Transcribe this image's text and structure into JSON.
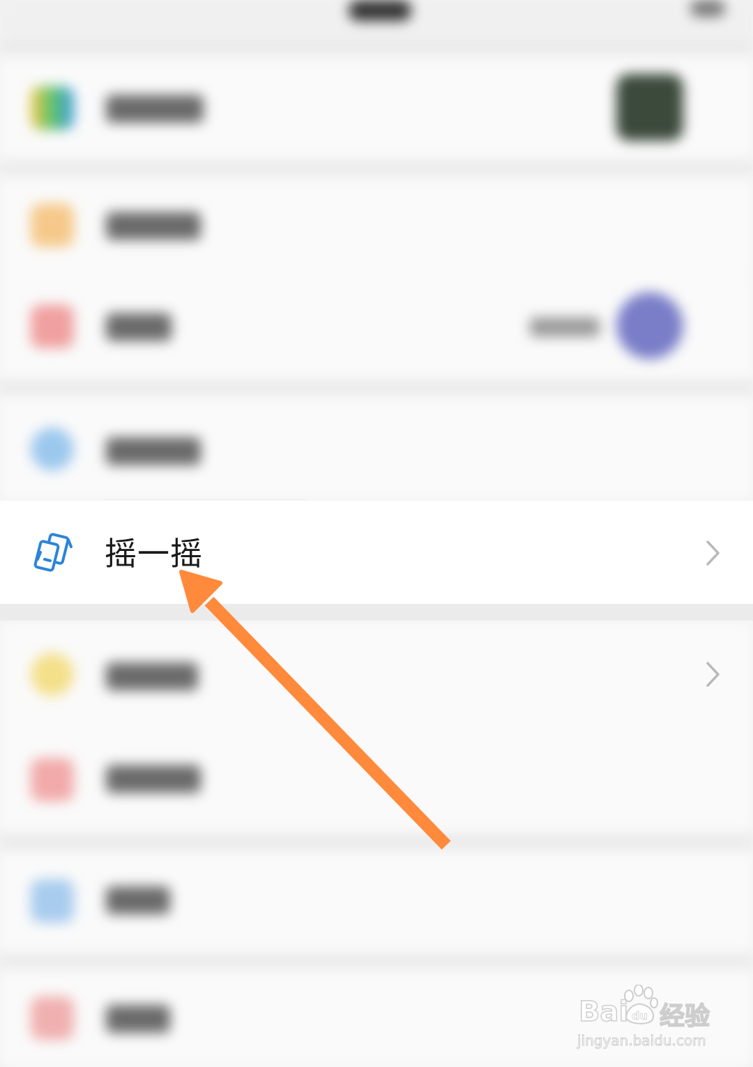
{
  "menu": {
    "shake": {
      "label": "摇一摇",
      "icon": "shake-phones-icon"
    }
  },
  "colors": {
    "shake_icon": "#2d84d8",
    "arrow": "#ff8a3c",
    "chevron": "#b9b9b9"
  },
  "watermark": {
    "brand": "Bai",
    "paw_text": "du",
    "jingyan": "经验",
    "url": "jingyan.baidu.com"
  }
}
